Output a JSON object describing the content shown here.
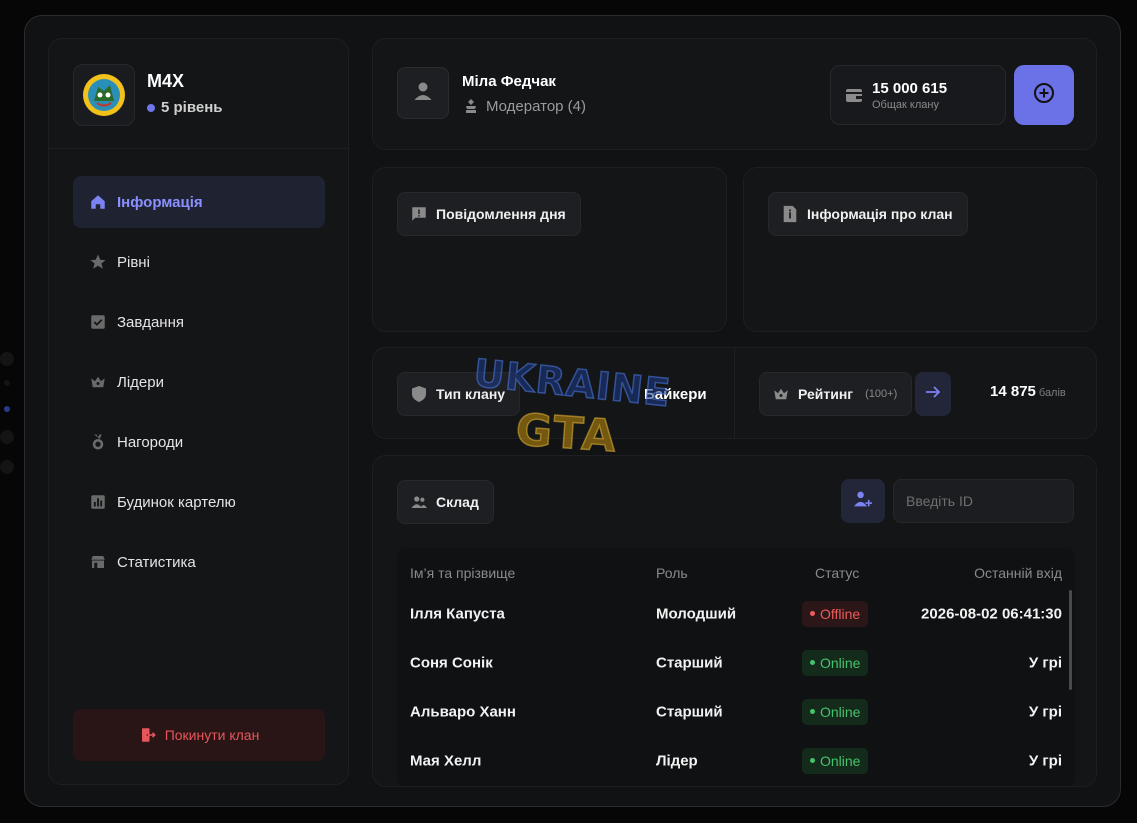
{
  "clan": {
    "name": "M4X",
    "level": "5 рівень"
  },
  "nav": {
    "items": [
      {
        "label": "Інформація",
        "icon": "home-icon",
        "active": true
      },
      {
        "label": "Рівні",
        "icon": "star-icon"
      },
      {
        "label": "Завдання",
        "icon": "checkbox-icon"
      },
      {
        "label": "Лідери",
        "icon": "crown-icon"
      },
      {
        "label": "Нагороди",
        "icon": "medal-icon"
      },
      {
        "label": "Будинок картелю",
        "icon": "bar-chart-icon"
      },
      {
        "label": "Статистика",
        "icon": "building-icon"
      }
    ],
    "leave_label": "Покинути клан"
  },
  "profile": {
    "name": "Міла Федчак",
    "role": "Модератор (4)"
  },
  "balance": {
    "amount": "15 000 615",
    "label": "Общак клану"
  },
  "motd": {
    "label": "Повідомлення дня"
  },
  "clan_info": {
    "label": "Інформація про клан"
  },
  "clan_type": {
    "label": "Тип клану",
    "value": "Байкери"
  },
  "rating": {
    "label": "Рейтинг",
    "hint": "(100+)",
    "value": "14 875",
    "unit": "балів"
  },
  "stock": {
    "label": "Склад",
    "search_placeholder": "Введіть ID",
    "columns": {
      "name": "Ім’я та прізвище",
      "role": "Роль",
      "status": "Статус",
      "last": "Останній вхід"
    },
    "rows": [
      {
        "name": "Ілля Капуста",
        "role": "Молодший",
        "status": "Offline",
        "last": "2026-08-02 06:41:30"
      },
      {
        "name": "Соня Сонік",
        "role": "Старший",
        "status": "Online",
        "last": "У грі"
      },
      {
        "name": "Альваро Ханн",
        "role": "Старший",
        "status": "Online",
        "last": "У грі"
      },
      {
        "name": "Мая Хелл",
        "role": "Лідер",
        "status": "Online",
        "last": "У грі"
      }
    ]
  },
  "watermark": {
    "line1": "UKRAINE",
    "line2": "GTA"
  },
  "colors": {
    "accent": "#6b71e6",
    "online": "#46c26d",
    "offline": "#ef5a5a",
    "danger": "#e7565a"
  }
}
